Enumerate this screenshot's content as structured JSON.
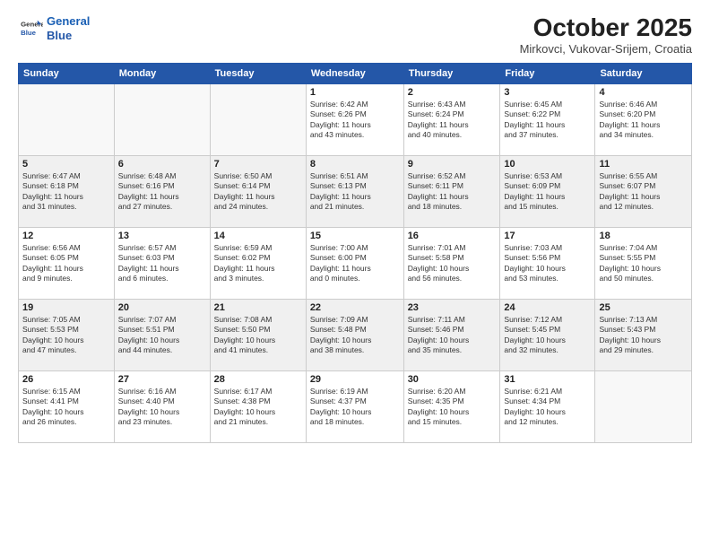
{
  "header": {
    "logo_line1": "General",
    "logo_line2": "Blue",
    "month": "October 2025",
    "location": "Mirkovci, Vukovar-Srijem, Croatia"
  },
  "weekdays": [
    "Sunday",
    "Monday",
    "Tuesday",
    "Wednesday",
    "Thursday",
    "Friday",
    "Saturday"
  ],
  "weeks": [
    [
      {
        "day": "",
        "info": ""
      },
      {
        "day": "",
        "info": ""
      },
      {
        "day": "",
        "info": ""
      },
      {
        "day": "1",
        "info": "Sunrise: 6:42 AM\nSunset: 6:26 PM\nDaylight: 11 hours\nand 43 minutes."
      },
      {
        "day": "2",
        "info": "Sunrise: 6:43 AM\nSunset: 6:24 PM\nDaylight: 11 hours\nand 40 minutes."
      },
      {
        "day": "3",
        "info": "Sunrise: 6:45 AM\nSunset: 6:22 PM\nDaylight: 11 hours\nand 37 minutes."
      },
      {
        "day": "4",
        "info": "Sunrise: 6:46 AM\nSunset: 6:20 PM\nDaylight: 11 hours\nand 34 minutes."
      }
    ],
    [
      {
        "day": "5",
        "info": "Sunrise: 6:47 AM\nSunset: 6:18 PM\nDaylight: 11 hours\nand 31 minutes."
      },
      {
        "day": "6",
        "info": "Sunrise: 6:48 AM\nSunset: 6:16 PM\nDaylight: 11 hours\nand 27 minutes."
      },
      {
        "day": "7",
        "info": "Sunrise: 6:50 AM\nSunset: 6:14 PM\nDaylight: 11 hours\nand 24 minutes."
      },
      {
        "day": "8",
        "info": "Sunrise: 6:51 AM\nSunset: 6:13 PM\nDaylight: 11 hours\nand 21 minutes."
      },
      {
        "day": "9",
        "info": "Sunrise: 6:52 AM\nSunset: 6:11 PM\nDaylight: 11 hours\nand 18 minutes."
      },
      {
        "day": "10",
        "info": "Sunrise: 6:53 AM\nSunset: 6:09 PM\nDaylight: 11 hours\nand 15 minutes."
      },
      {
        "day": "11",
        "info": "Sunrise: 6:55 AM\nSunset: 6:07 PM\nDaylight: 11 hours\nand 12 minutes."
      }
    ],
    [
      {
        "day": "12",
        "info": "Sunrise: 6:56 AM\nSunset: 6:05 PM\nDaylight: 11 hours\nand 9 minutes."
      },
      {
        "day": "13",
        "info": "Sunrise: 6:57 AM\nSunset: 6:03 PM\nDaylight: 11 hours\nand 6 minutes."
      },
      {
        "day": "14",
        "info": "Sunrise: 6:59 AM\nSunset: 6:02 PM\nDaylight: 11 hours\nand 3 minutes."
      },
      {
        "day": "15",
        "info": "Sunrise: 7:00 AM\nSunset: 6:00 PM\nDaylight: 11 hours\nand 0 minutes."
      },
      {
        "day": "16",
        "info": "Sunrise: 7:01 AM\nSunset: 5:58 PM\nDaylight: 10 hours\nand 56 minutes."
      },
      {
        "day": "17",
        "info": "Sunrise: 7:03 AM\nSunset: 5:56 PM\nDaylight: 10 hours\nand 53 minutes."
      },
      {
        "day": "18",
        "info": "Sunrise: 7:04 AM\nSunset: 5:55 PM\nDaylight: 10 hours\nand 50 minutes."
      }
    ],
    [
      {
        "day": "19",
        "info": "Sunrise: 7:05 AM\nSunset: 5:53 PM\nDaylight: 10 hours\nand 47 minutes."
      },
      {
        "day": "20",
        "info": "Sunrise: 7:07 AM\nSunset: 5:51 PM\nDaylight: 10 hours\nand 44 minutes."
      },
      {
        "day": "21",
        "info": "Sunrise: 7:08 AM\nSunset: 5:50 PM\nDaylight: 10 hours\nand 41 minutes."
      },
      {
        "day": "22",
        "info": "Sunrise: 7:09 AM\nSunset: 5:48 PM\nDaylight: 10 hours\nand 38 minutes."
      },
      {
        "day": "23",
        "info": "Sunrise: 7:11 AM\nSunset: 5:46 PM\nDaylight: 10 hours\nand 35 minutes."
      },
      {
        "day": "24",
        "info": "Sunrise: 7:12 AM\nSunset: 5:45 PM\nDaylight: 10 hours\nand 32 minutes."
      },
      {
        "day": "25",
        "info": "Sunrise: 7:13 AM\nSunset: 5:43 PM\nDaylight: 10 hours\nand 29 minutes."
      }
    ],
    [
      {
        "day": "26",
        "info": "Sunrise: 6:15 AM\nSunset: 4:41 PM\nDaylight: 10 hours\nand 26 minutes."
      },
      {
        "day": "27",
        "info": "Sunrise: 6:16 AM\nSunset: 4:40 PM\nDaylight: 10 hours\nand 23 minutes."
      },
      {
        "day": "28",
        "info": "Sunrise: 6:17 AM\nSunset: 4:38 PM\nDaylight: 10 hours\nand 21 minutes."
      },
      {
        "day": "29",
        "info": "Sunrise: 6:19 AM\nSunset: 4:37 PM\nDaylight: 10 hours\nand 18 minutes."
      },
      {
        "day": "30",
        "info": "Sunrise: 6:20 AM\nSunset: 4:35 PM\nDaylight: 10 hours\nand 15 minutes."
      },
      {
        "day": "31",
        "info": "Sunrise: 6:21 AM\nSunset: 4:34 PM\nDaylight: 10 hours\nand 12 minutes."
      },
      {
        "day": "",
        "info": ""
      }
    ]
  ]
}
